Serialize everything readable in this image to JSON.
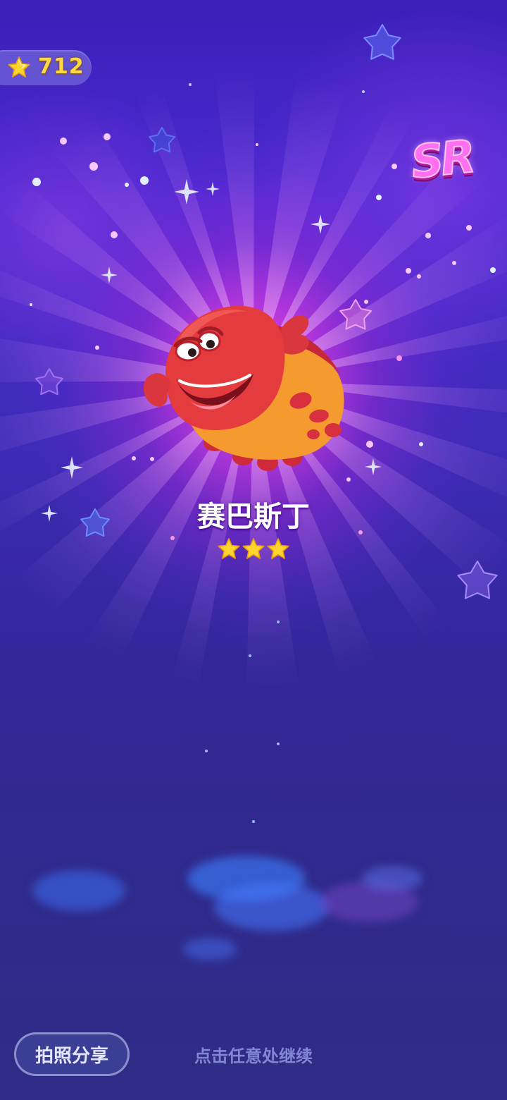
{
  "currency": {
    "icon": "star-icon",
    "count": "712"
  },
  "rarity": {
    "label": "SR"
  },
  "character": {
    "name": "赛巴斯丁",
    "stars": 3,
    "icon": "red-crab-character"
  },
  "footer": {
    "share_label": "拍照分享",
    "hint": "点击任意处继续"
  },
  "colors": {
    "background": "#3a2ac0",
    "glow": "#ff78ff",
    "currency_text": "#ffd845",
    "sr_badge": "#ff6ff0",
    "rating_star": "#ffd52e",
    "share_button_bg": "#3c4096"
  }
}
